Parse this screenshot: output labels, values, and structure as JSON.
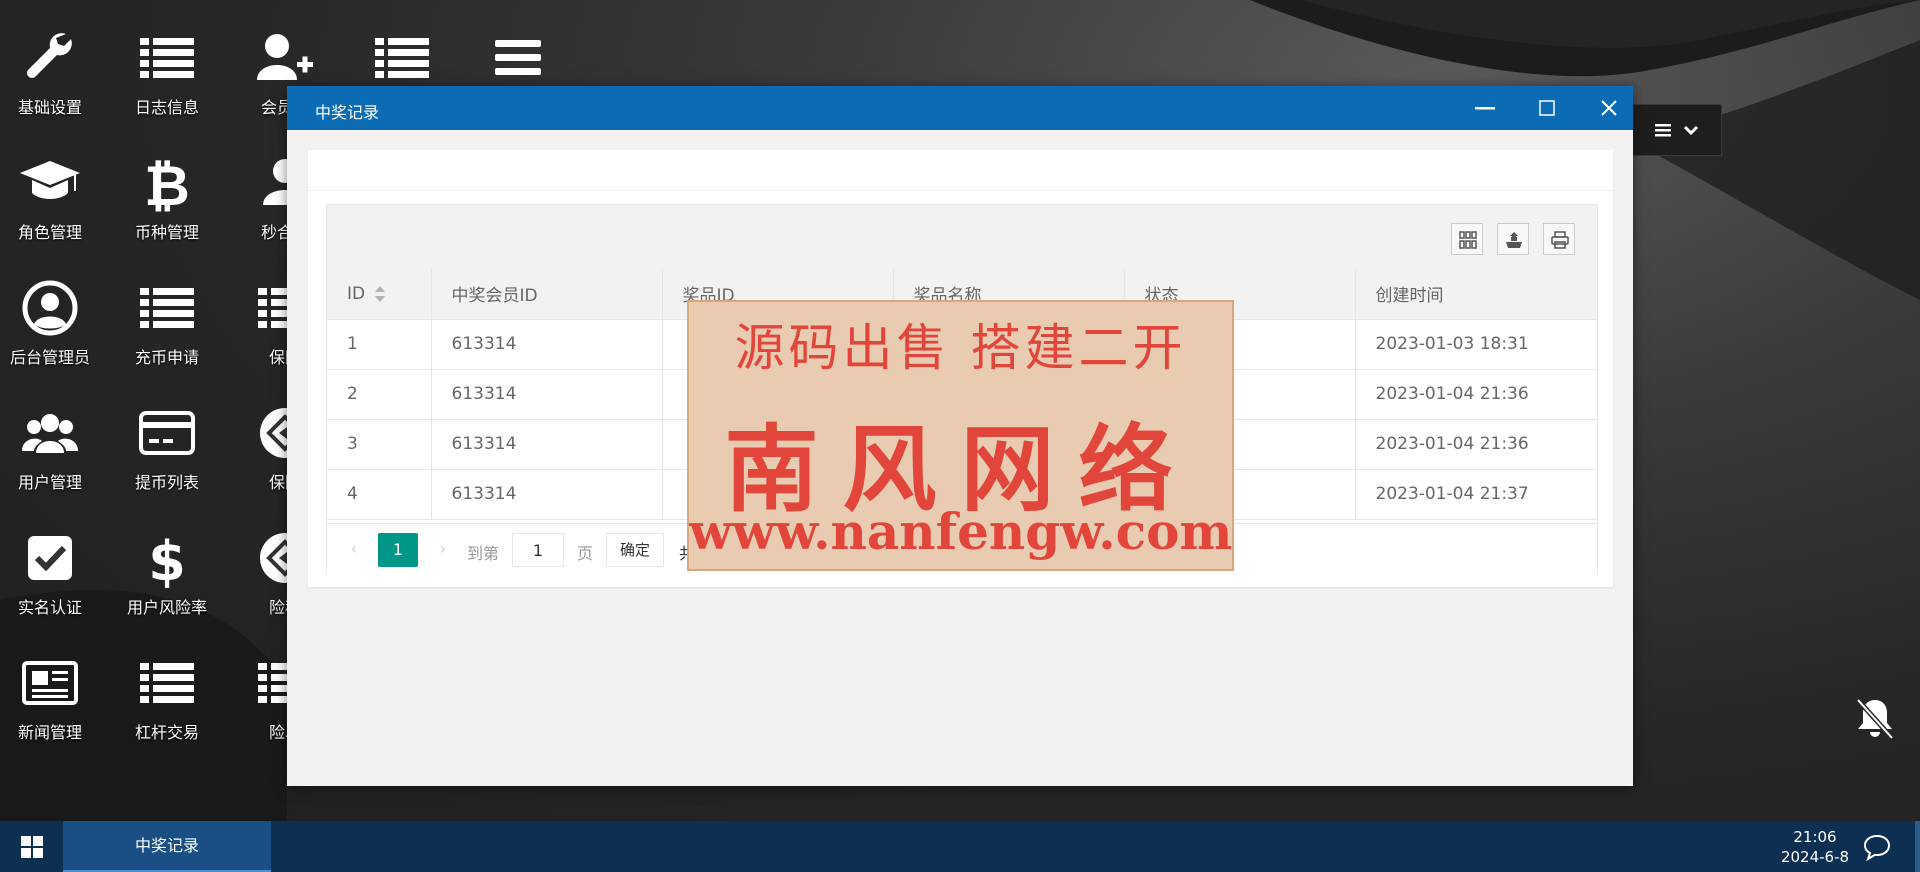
{
  "desktop": {
    "icons": [
      {
        "label": "基础设置",
        "icon": "wrench-icon"
      },
      {
        "label": "日志信息",
        "icon": "list-icon"
      },
      {
        "label": "会员关",
        "icon": "user-plus-icon"
      },
      {
        "label": "",
        "icon": "list-icon"
      },
      {
        "label": "",
        "icon": "bars-icon"
      },
      {
        "label": "角色管理",
        "icon": "graduation-cap-icon"
      },
      {
        "label": "币种管理",
        "icon": "bitcoin-icon"
      },
      {
        "label": "秒合约",
        "icon": "user-icon"
      },
      {
        "label": "后台管理员",
        "icon": "user-circle-icon"
      },
      {
        "label": "充币申请",
        "icon": "list-icon"
      },
      {
        "label": "保险",
        "icon": "list-icon"
      },
      {
        "label": "用户管理",
        "icon": "users-icon"
      },
      {
        "label": "提币列表",
        "icon": "credit-card-icon"
      },
      {
        "label": "保险",
        "icon": "diamond-arrow-icon"
      },
      {
        "label": "实名认证",
        "icon": "check-square-icon"
      },
      {
        "label": "用户风险率",
        "icon": "dollar-icon"
      },
      {
        "label": "险种",
        "icon": "diamond-arrow-icon"
      },
      {
        "label": "新闻管理",
        "icon": "newspaper-icon"
      },
      {
        "label": "杠杆交易",
        "icon": "list-icon"
      },
      {
        "label": "险单",
        "icon": "list-icon"
      }
    ]
  },
  "window": {
    "title": "中奖记录"
  },
  "table": {
    "columns": [
      "ID",
      "中奖会员ID",
      "奖品ID",
      "奖品名称",
      "状态",
      "创建时间"
    ],
    "rows": [
      [
        "1",
        "613314",
        "",
        "",
        "",
        "2023-01-03 18:31"
      ],
      [
        "2",
        "613314",
        "",
        "",
        "",
        "2023-01-04 21:36"
      ],
      [
        "3",
        "613314",
        "",
        "",
        "",
        "2023-01-04 21:36"
      ],
      [
        "4",
        "613314",
        "",
        "",
        "",
        "2023-01-04 21:37"
      ]
    ]
  },
  "pager": {
    "current": "1",
    "goto_label": "到第",
    "input_value": "1",
    "page_label": "页",
    "confirm": "确定",
    "total_prefix": "共"
  },
  "watermark": {
    "line1": "源码出售  搭建二开",
    "line2": "南风网络",
    "line3": "www.nanfengw.com"
  },
  "taskbar": {
    "task": "中奖记录",
    "time": "21:06",
    "date": "2024-6-8"
  },
  "colors": {
    "titlebar": "#0b6cb5",
    "taskbar": "#0c2f52",
    "page_active": "#009688",
    "watermark_text": "#e2463a"
  }
}
